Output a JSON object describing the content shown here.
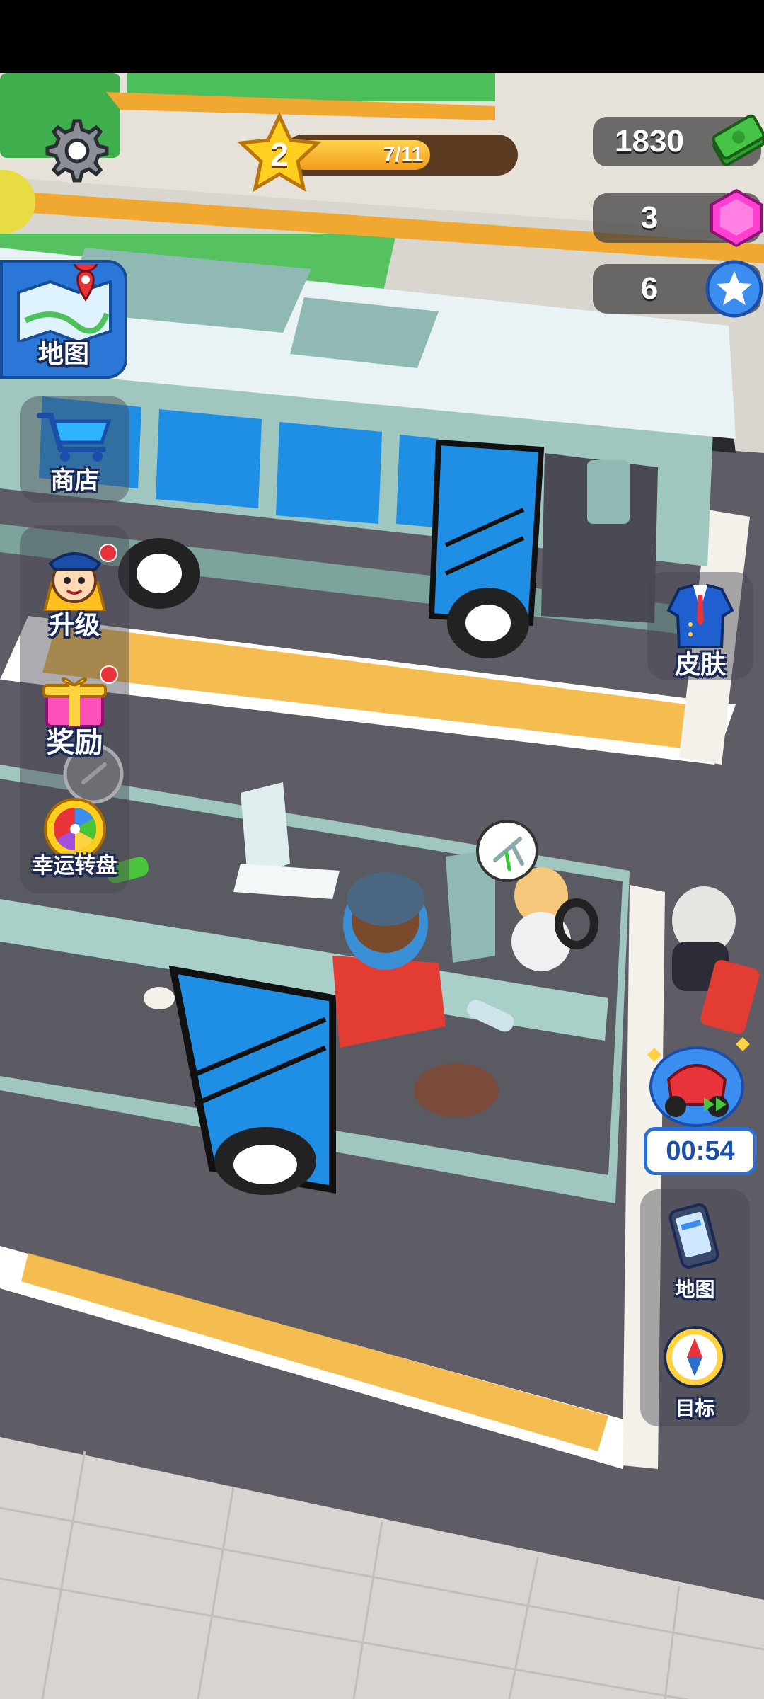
{
  "hud": {
    "level": "2",
    "progress_text": "7/11",
    "progress_fraction": 0.636,
    "currency": {
      "cash": "1830",
      "gems": "3",
      "stars": "6"
    }
  },
  "left_menu": {
    "map": "地图",
    "shop": "商店",
    "upgrade": "升级",
    "rewards": "奖励",
    "lucky_wheel": "幸运转盘"
  },
  "right_menu": {
    "skin": "皮肤",
    "boost_timer": "00:54",
    "phone_map": "地图",
    "target": "目标"
  },
  "icons": {
    "settings": "gear-icon",
    "cash": "cash-stack-icon",
    "gem": "pink-gem-icon",
    "star": "blue-star-icon",
    "map": "map-pin-icon",
    "shop": "shopping-cart-icon",
    "upgrade": "driver-avatar-icon",
    "rewards": "gift-box-icon",
    "lucky_wheel": "color-wheel-icon",
    "skin": "uniform-icon",
    "boost": "scooter-boost-icon",
    "phone": "phone-icon",
    "target": "compass-icon",
    "clean_task": "broom-icon"
  },
  "colors": {
    "accent_yellow": "#f5b431",
    "ui_blue": "#2b6fd0",
    "bus_blue": "#1f8fe5",
    "bus_teal": "#8fb9b2",
    "badge_red": "#e8333a"
  }
}
